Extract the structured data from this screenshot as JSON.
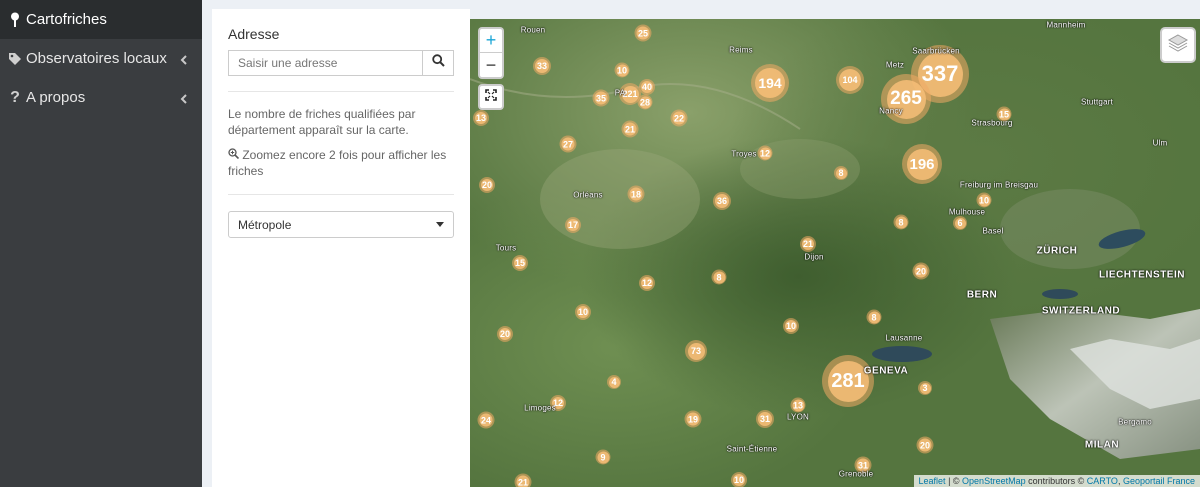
{
  "sidebar": {
    "items": [
      {
        "label": "Cartofriches",
        "icon": "map-pin-icon",
        "active": true
      },
      {
        "label": "Observatoires locaux",
        "icon": "tag-icon",
        "chevron": true
      },
      {
        "label": "A propos",
        "icon": "question-icon",
        "chevron": true
      }
    ]
  },
  "panel": {
    "address_label": "Adresse",
    "address_placeholder": "Saisir une adresse",
    "info_text": "Le nombre de friches qualifiées par département apparaît sur la carte.",
    "zoom_hint": "Zoomez encore 2 fois pour afficher les friches",
    "select_value": "Métropole"
  },
  "map": {
    "zoom_in": "+",
    "zoom_out": "−",
    "attribution": {
      "leaflet": "Leaflet",
      "sep1": " | © ",
      "osm": "OpenStreetMap",
      "contrib": " contributors © ",
      "carto": "CARTO",
      "sep2": ", ",
      "geoportail": "Geoportail France"
    },
    "clusters": [
      {
        "v": "25"
      },
      {
        "v": "33"
      },
      {
        "v": "10"
      },
      {
        "v": "40"
      },
      {
        "v": "221"
      },
      {
        "v": "35"
      },
      {
        "v": "28"
      },
      {
        "v": "13"
      },
      {
        "v": "21"
      },
      {
        "v": "22"
      },
      {
        "v": "27"
      },
      {
        "v": "194"
      },
      {
        "v": "104"
      },
      {
        "v": "337"
      },
      {
        "v": "265"
      },
      {
        "v": "15"
      },
      {
        "v": "196"
      },
      {
        "v": "12"
      },
      {
        "v": "20"
      },
      {
        "v": "18"
      },
      {
        "v": "8"
      },
      {
        "v": "36"
      },
      {
        "v": "10"
      },
      {
        "v": "17"
      },
      {
        "v": "8"
      },
      {
        "v": "6"
      },
      {
        "v": "21"
      },
      {
        "v": "15"
      },
      {
        "v": "12"
      },
      {
        "v": "8"
      },
      {
        "v": "20"
      },
      {
        "v": "10"
      },
      {
        "v": "20"
      },
      {
        "v": "10"
      },
      {
        "v": "8"
      },
      {
        "v": "73"
      },
      {
        "v": "4"
      },
      {
        "v": "281"
      },
      {
        "v": "3"
      },
      {
        "v": "13"
      },
      {
        "v": "12"
      },
      {
        "v": "24"
      },
      {
        "v": "19"
      },
      {
        "v": "31"
      },
      {
        "v": "9"
      },
      {
        "v": "20"
      },
      {
        "v": "31"
      },
      {
        "v": "21"
      },
      {
        "v": "10"
      }
    ],
    "cities": [
      "Rouen",
      "Reims",
      "Metz",
      "Saarbrücken",
      "Mannheim",
      "Nancy",
      "Strasbourg",
      "Stuttgart",
      "Ulm",
      "Troyes",
      "Orléans",
      "Freiburg im Breisgau",
      "Mulhouse",
      "Basel",
      "Tours",
      "ZÜRICH",
      "LIECHTENSTEIN",
      "Dijon",
      "BERN",
      "SWITZERLAND",
      "Lausanne",
      "GENEVA",
      "Limoges",
      "LYON",
      "Saint-Étienne",
      "Bergamo",
      "MILAN",
      "Grenoble",
      "PA"
    ]
  }
}
